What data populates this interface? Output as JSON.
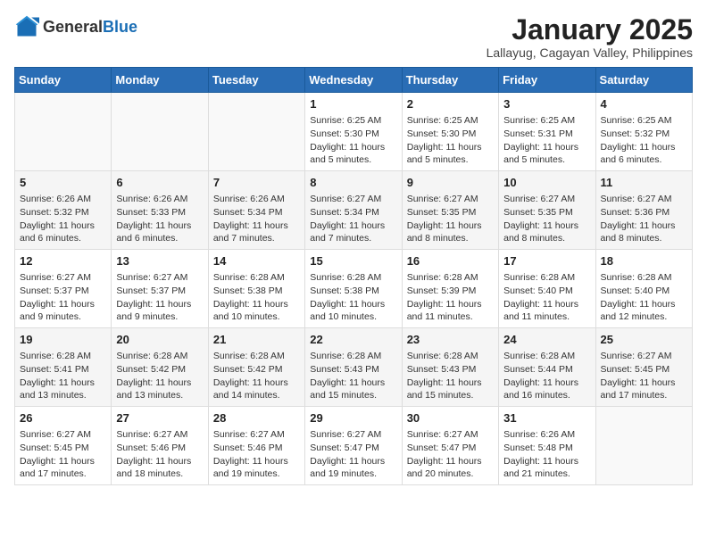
{
  "header": {
    "logo_general": "General",
    "logo_blue": "Blue",
    "title": "January 2025",
    "subtitle": "Lallayug, Cagayan Valley, Philippines"
  },
  "days_of_week": [
    "Sunday",
    "Monday",
    "Tuesday",
    "Wednesday",
    "Thursday",
    "Friday",
    "Saturday"
  ],
  "weeks": [
    [
      {
        "day": "",
        "text": ""
      },
      {
        "day": "",
        "text": ""
      },
      {
        "day": "",
        "text": ""
      },
      {
        "day": "1",
        "text": "Sunrise: 6:25 AM\nSunset: 5:30 PM\nDaylight: 11 hours and 5 minutes."
      },
      {
        "day": "2",
        "text": "Sunrise: 6:25 AM\nSunset: 5:30 PM\nDaylight: 11 hours and 5 minutes."
      },
      {
        "day": "3",
        "text": "Sunrise: 6:25 AM\nSunset: 5:31 PM\nDaylight: 11 hours and 5 minutes."
      },
      {
        "day": "4",
        "text": "Sunrise: 6:25 AM\nSunset: 5:32 PM\nDaylight: 11 hours and 6 minutes."
      }
    ],
    [
      {
        "day": "5",
        "text": "Sunrise: 6:26 AM\nSunset: 5:32 PM\nDaylight: 11 hours and 6 minutes."
      },
      {
        "day": "6",
        "text": "Sunrise: 6:26 AM\nSunset: 5:33 PM\nDaylight: 11 hours and 6 minutes."
      },
      {
        "day": "7",
        "text": "Sunrise: 6:26 AM\nSunset: 5:34 PM\nDaylight: 11 hours and 7 minutes."
      },
      {
        "day": "8",
        "text": "Sunrise: 6:27 AM\nSunset: 5:34 PM\nDaylight: 11 hours and 7 minutes."
      },
      {
        "day": "9",
        "text": "Sunrise: 6:27 AM\nSunset: 5:35 PM\nDaylight: 11 hours and 8 minutes."
      },
      {
        "day": "10",
        "text": "Sunrise: 6:27 AM\nSunset: 5:35 PM\nDaylight: 11 hours and 8 minutes."
      },
      {
        "day": "11",
        "text": "Sunrise: 6:27 AM\nSunset: 5:36 PM\nDaylight: 11 hours and 8 minutes."
      }
    ],
    [
      {
        "day": "12",
        "text": "Sunrise: 6:27 AM\nSunset: 5:37 PM\nDaylight: 11 hours and 9 minutes."
      },
      {
        "day": "13",
        "text": "Sunrise: 6:27 AM\nSunset: 5:37 PM\nDaylight: 11 hours and 9 minutes."
      },
      {
        "day": "14",
        "text": "Sunrise: 6:28 AM\nSunset: 5:38 PM\nDaylight: 11 hours and 10 minutes."
      },
      {
        "day": "15",
        "text": "Sunrise: 6:28 AM\nSunset: 5:38 PM\nDaylight: 11 hours and 10 minutes."
      },
      {
        "day": "16",
        "text": "Sunrise: 6:28 AM\nSunset: 5:39 PM\nDaylight: 11 hours and 11 minutes."
      },
      {
        "day": "17",
        "text": "Sunrise: 6:28 AM\nSunset: 5:40 PM\nDaylight: 11 hours and 11 minutes."
      },
      {
        "day": "18",
        "text": "Sunrise: 6:28 AM\nSunset: 5:40 PM\nDaylight: 11 hours and 12 minutes."
      }
    ],
    [
      {
        "day": "19",
        "text": "Sunrise: 6:28 AM\nSunset: 5:41 PM\nDaylight: 11 hours and 13 minutes."
      },
      {
        "day": "20",
        "text": "Sunrise: 6:28 AM\nSunset: 5:42 PM\nDaylight: 11 hours and 13 minutes."
      },
      {
        "day": "21",
        "text": "Sunrise: 6:28 AM\nSunset: 5:42 PM\nDaylight: 11 hours and 14 minutes."
      },
      {
        "day": "22",
        "text": "Sunrise: 6:28 AM\nSunset: 5:43 PM\nDaylight: 11 hours and 15 minutes."
      },
      {
        "day": "23",
        "text": "Sunrise: 6:28 AM\nSunset: 5:43 PM\nDaylight: 11 hours and 15 minutes."
      },
      {
        "day": "24",
        "text": "Sunrise: 6:28 AM\nSunset: 5:44 PM\nDaylight: 11 hours and 16 minutes."
      },
      {
        "day": "25",
        "text": "Sunrise: 6:27 AM\nSunset: 5:45 PM\nDaylight: 11 hours and 17 minutes."
      }
    ],
    [
      {
        "day": "26",
        "text": "Sunrise: 6:27 AM\nSunset: 5:45 PM\nDaylight: 11 hours and 17 minutes."
      },
      {
        "day": "27",
        "text": "Sunrise: 6:27 AM\nSunset: 5:46 PM\nDaylight: 11 hours and 18 minutes."
      },
      {
        "day": "28",
        "text": "Sunrise: 6:27 AM\nSunset: 5:46 PM\nDaylight: 11 hours and 19 minutes."
      },
      {
        "day": "29",
        "text": "Sunrise: 6:27 AM\nSunset: 5:47 PM\nDaylight: 11 hours and 19 minutes."
      },
      {
        "day": "30",
        "text": "Sunrise: 6:27 AM\nSunset: 5:47 PM\nDaylight: 11 hours and 20 minutes."
      },
      {
        "day": "31",
        "text": "Sunrise: 6:26 AM\nSunset: 5:48 PM\nDaylight: 11 hours and 21 minutes."
      },
      {
        "day": "",
        "text": ""
      }
    ]
  ]
}
